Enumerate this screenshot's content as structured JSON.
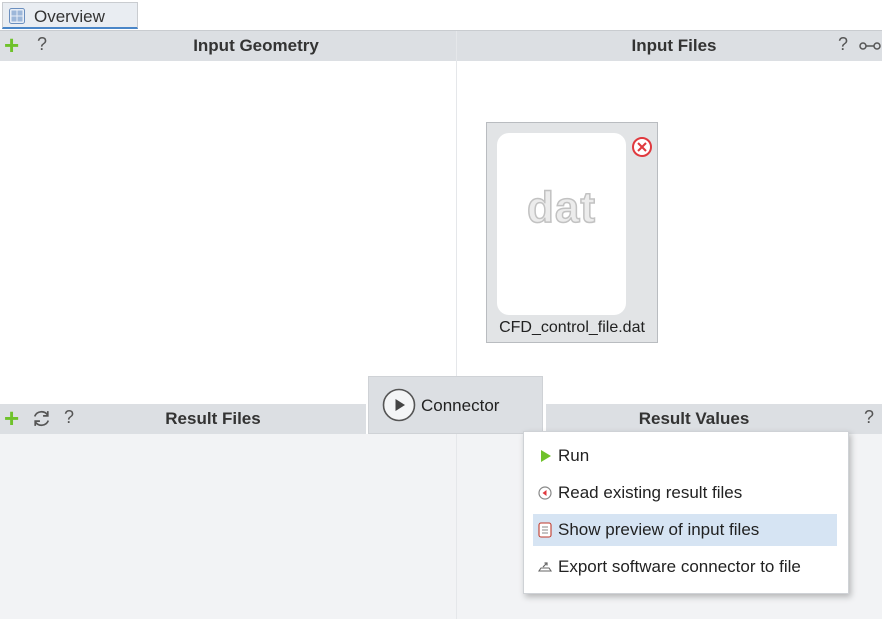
{
  "tab": {
    "label": "Overview",
    "icon": "overview-grid-icon"
  },
  "input_geometry": {
    "title": "Input Geometry",
    "help": "?"
  },
  "input_files": {
    "title": "Input Files",
    "help": "?",
    "files": [
      {
        "extension": "dat",
        "name": "CFD_control_file.dat"
      }
    ]
  },
  "result_files": {
    "title": "Result Files",
    "help": "?"
  },
  "result_values": {
    "title": "Result Values",
    "help": "?"
  },
  "connector": {
    "label": "Connector"
  },
  "context_menu": {
    "items": [
      {
        "label": "Run",
        "icon": "play-icon"
      },
      {
        "label": "Read existing result files",
        "icon": "read-results-icon"
      },
      {
        "label": "Show preview of input files",
        "icon": "document-preview-icon",
        "highlighted": true
      },
      {
        "label": "Export software connector to file",
        "icon": "export-icon"
      }
    ]
  },
  "colors": {
    "accent": "#4a86c8",
    "add_green": "#6fc22b",
    "remove_red": "#e0393e",
    "header_bg": "#dcdfe3",
    "highlight": "#d6e4f3"
  }
}
